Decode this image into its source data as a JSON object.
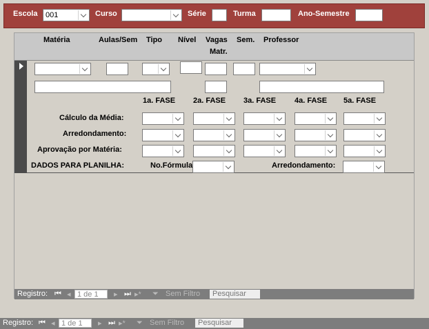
{
  "header": {
    "escola_label": "Escola",
    "escola_value": "001",
    "curso_label": "Curso",
    "serie_label": "Série",
    "turma_label": "Turma",
    "ano_label": "Ano-Semestre"
  },
  "columns": {
    "materia": "Matéria",
    "aulas": "Aulas/Sem",
    "tipo": "Tipo",
    "nivel": "Nível",
    "vagas": "Vagas",
    "matr": "Matr.",
    "sem": "Sem.",
    "professor": "Professor"
  },
  "fases": [
    "1a. FASE",
    "2a. FASE",
    "3a. FASE",
    "4a. FASE",
    "5a. FASE"
  ],
  "rows": {
    "calculo": "Cálculo da Média:",
    "arredondamento": "Arredondamento:",
    "aprovacao": "Aprovação por Matéria:",
    "dados": "DADOS PARA PLANILHA:",
    "formula": "No.Fórmula:",
    "arred2": "Arredondamento:"
  },
  "subnav": {
    "label": "Registro:",
    "record": "1 de 1",
    "filter": "Sem Filtro",
    "search": "Pesquisar"
  },
  "mainnav": {
    "label": "Registro:",
    "record": "1 de 1",
    "filter": "Sem Filtro",
    "search": "Pesquisar"
  },
  "colors": {
    "header_bg": "#a0413c",
    "nav_bg": "#7d7d7d"
  }
}
